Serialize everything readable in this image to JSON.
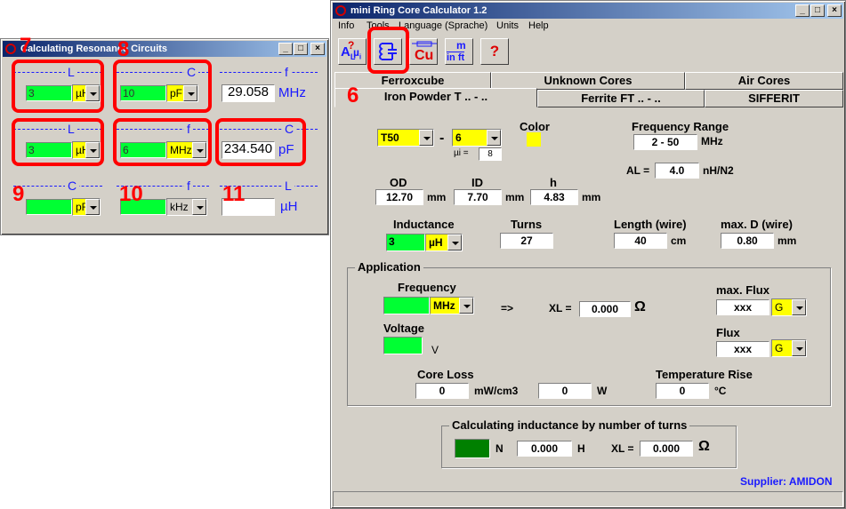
{
  "resonance": {
    "title": "Calculating Resonance Circuits",
    "row1": {
      "l_label": "L",
      "c_label": "C",
      "f_label": "f",
      "l_value": "3",
      "l_unit": "µH",
      "c_value": "10",
      "c_unit": "pF",
      "f_result": "29.058",
      "f_unit": "MHz"
    },
    "row2": {
      "l_label": "L",
      "f_label": "f",
      "c_label": "C",
      "l_value": "3",
      "l_unit": "µH",
      "f_value": "6",
      "f_unit": "MHz",
      "c_result": "234.540",
      "c_unit": "pF"
    },
    "row3": {
      "c_label": "C",
      "f_label": "f",
      "l_label": "L",
      "c_value": "",
      "c_unit": "pF",
      "f_value": "",
      "f_unit": "kHz",
      "l_result": "",
      "l_unit": "µH"
    }
  },
  "annotations": {
    "n6": "6",
    "n7": "7",
    "n8": "8",
    "n9": "9",
    "n10": "10",
    "n11": "11"
  },
  "main": {
    "title": "mini Ring Core Calculator 1.2",
    "menu": [
      "Info",
      "Tools",
      "Language (Sprache)",
      "Units",
      "Help"
    ],
    "toolbar": {
      "al_label": "A",
      "al_sub": "L",
      "mu_label": "µ",
      "mu_sub": "i",
      "cu_label": "Cu",
      "m_label": "m",
      "inft_label": "in ft",
      "help_label": "?"
    },
    "tabs_row1": [
      "Ferroxcube",
      "Unknown Cores",
      "Air Cores"
    ],
    "tabs_row2": [
      "Iron Powder T .. - ..",
      "Ferrite FT .. - ..",
      "SIFFERIT"
    ],
    "core": {
      "type": "T50",
      "dash": "-",
      "mix": "6",
      "ui_label": "µi =",
      "ui_value": "8",
      "color_label": "Color",
      "color_value": "#ffff00"
    },
    "freq_range": {
      "label": "Frequency Range",
      "value": "2 - 50",
      "unit": "MHz"
    },
    "al": {
      "label": "AL =",
      "value": "4.0",
      "unit": "nH/N2"
    },
    "dims": {
      "od_label": "OD",
      "id_label": "ID",
      "h_label": "h",
      "od": "12.70",
      "id": "7.70",
      "h": "4.83",
      "unit": "mm"
    },
    "inductance": {
      "label": "Inductance",
      "value": "3",
      "unit": "µH"
    },
    "turns": {
      "label": "Turns",
      "value": "27"
    },
    "length": {
      "label": "Length (wire)",
      "value": "40",
      "unit": "cm"
    },
    "maxd": {
      "label": "max. D (wire)",
      "value": "0.80",
      "unit": "mm"
    },
    "application": {
      "title": "Application",
      "freq_label": "Frequency",
      "freq_value": "",
      "freq_unit": "MHz",
      "arrow": "=>",
      "xl_label": "XL =",
      "xl_value": "0.000",
      "ohm": "Ω",
      "maxflux_label": "max. Flux",
      "maxflux_value": "xxx",
      "maxflux_unit": "G",
      "voltage_label": "Voltage",
      "voltage_value": "",
      "voltage_unit": "V",
      "flux_label": "Flux",
      "flux_value": "xxx",
      "flux_unit": "G",
      "coreloss_label": "Core Loss",
      "coreloss_value": "0",
      "coreloss_unit": "mW/cm3",
      "coreloss_w": "0",
      "w_unit": "W",
      "temprise_label": "Temperature Rise",
      "temprise_value": "0",
      "temprise_unit": "°C"
    },
    "by_turns": {
      "title": "Calculating inductance by number of turns",
      "n_value": "",
      "n_label": "N",
      "h_value": "0.000",
      "h_unit": "H",
      "xl_label": "XL =",
      "xl_value": "0.000",
      "ohm": "Ω"
    },
    "supplier": "Supplier: AMIDON"
  }
}
